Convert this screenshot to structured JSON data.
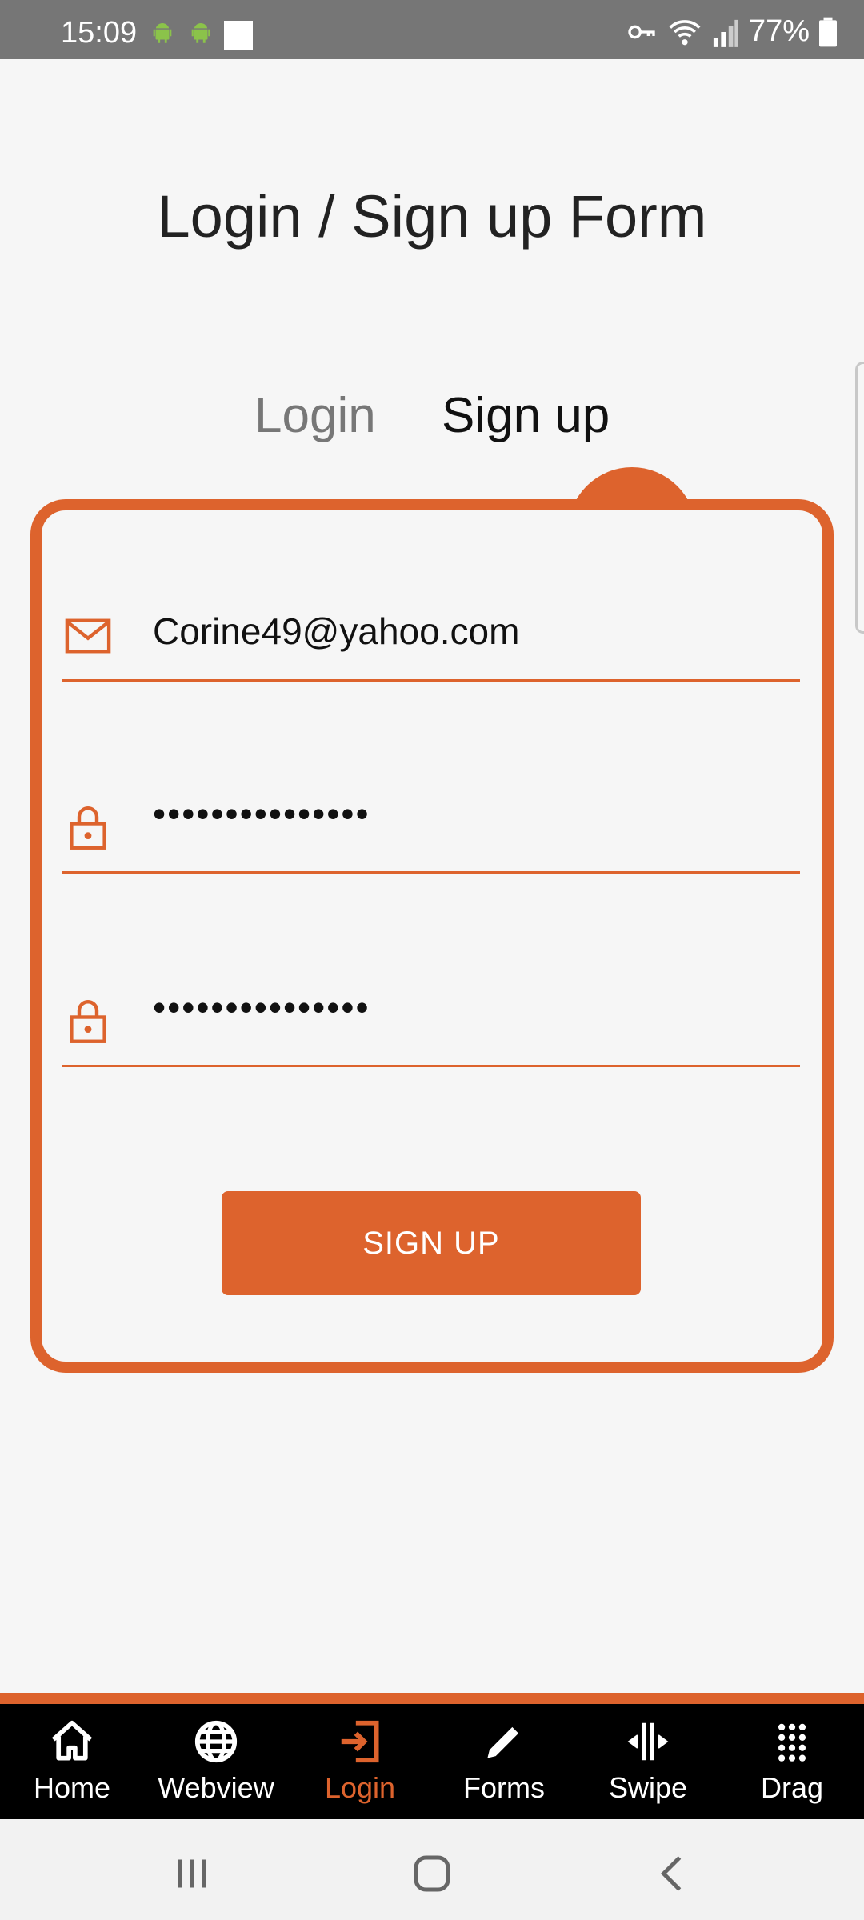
{
  "status_bar": {
    "time": "15:09",
    "battery": "77%"
  },
  "page": {
    "title": "Login / Sign up Form"
  },
  "tabs": [
    {
      "label": "Login",
      "active": false
    },
    {
      "label": "Sign up",
      "active": true
    }
  ],
  "form": {
    "email_value": "Corine49@yahoo.com",
    "password_value": "•••••••••••••••",
    "confirm_password_value": "•••••••••••••••",
    "submit_label": "SIGN UP"
  },
  "bottom_nav": [
    {
      "label": "Home",
      "icon": "home-icon",
      "active": false
    },
    {
      "label": "Webview",
      "icon": "globe-icon",
      "active": false
    },
    {
      "label": "Login",
      "icon": "login-icon",
      "active": true
    },
    {
      "label": "Forms",
      "icon": "pencil-icon",
      "active": false
    },
    {
      "label": "Swipe",
      "icon": "swipe-icon",
      "active": false
    },
    {
      "label": "Drag",
      "icon": "grid-icon",
      "active": false
    }
  ],
  "colors": {
    "accent": "#dd632d",
    "status_bar": "#767676",
    "background": "#f6f6f6",
    "nav_background": "#000000"
  }
}
